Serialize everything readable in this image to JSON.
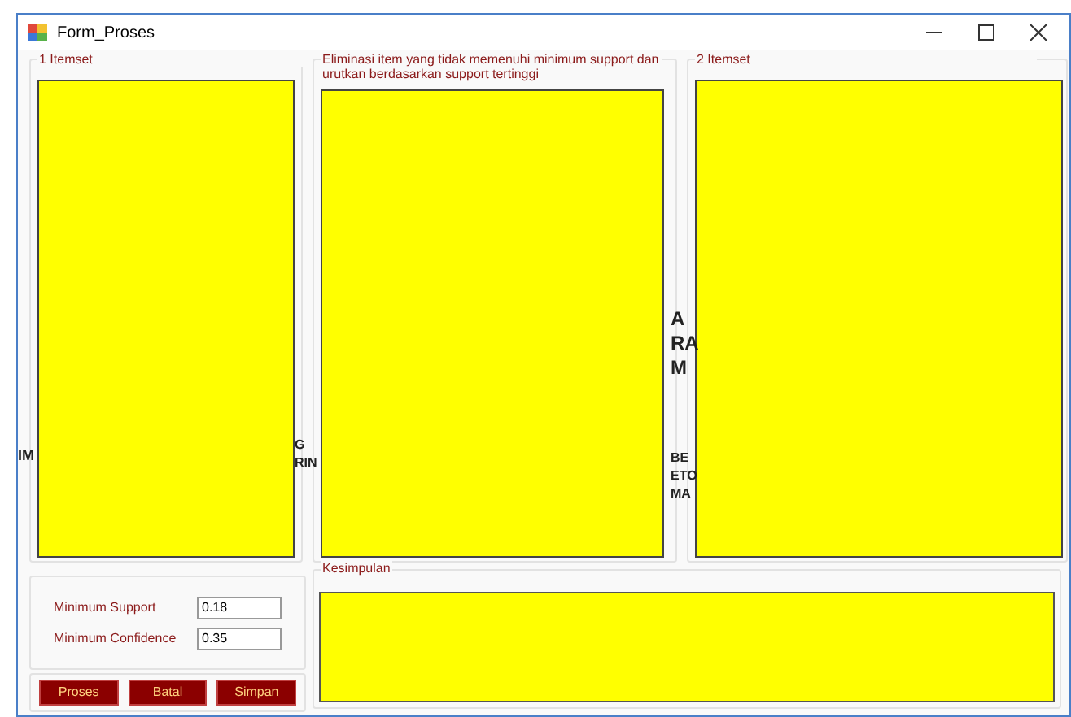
{
  "window": {
    "title": "Form_Proses"
  },
  "panels": [
    {
      "label": "1 Itemset"
    },
    {
      "label": "Eliminasi item yang tidak memenuhi minimum support dan urutkan berdasarkan support tertinggi"
    },
    {
      "label": "2 Itemset"
    }
  ],
  "background_fragments": [
    [
      "IM"
    ],
    [
      "G",
      "RIN"
    ],
    [
      "A",
      "RA",
      "M"
    ],
    [
      "BE",
      "ETO",
      "MA"
    ]
  ],
  "parameters": [
    {
      "label": "Minimum Support",
      "value": "0.18"
    },
    {
      "label": "Minimum Confidence",
      "value": "0.35"
    }
  ],
  "buttons": [
    "Proses",
    "Batal",
    "Simpan"
  ],
  "conclusion": {
    "label": "Kesimpulan"
  }
}
